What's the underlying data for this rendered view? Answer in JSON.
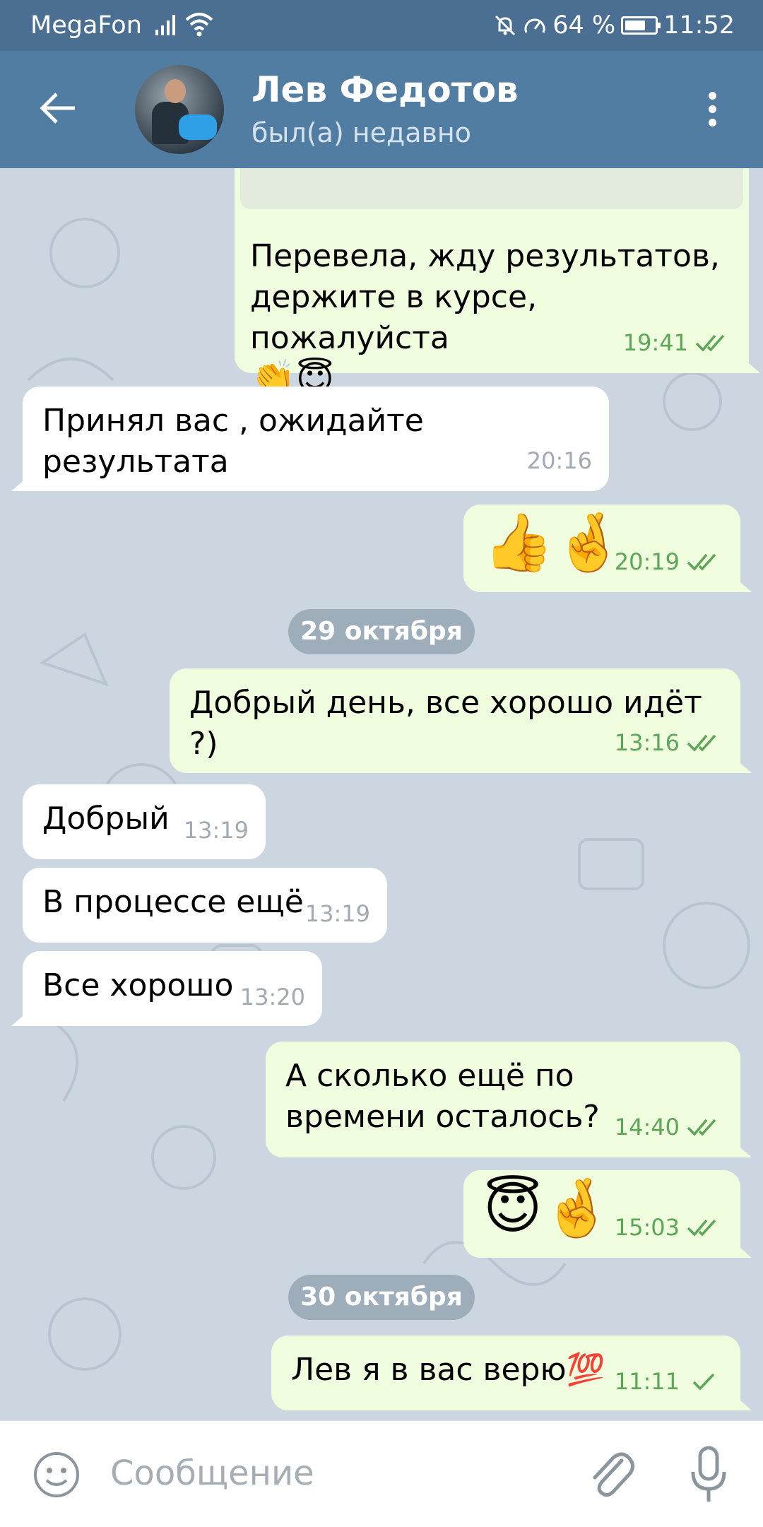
{
  "status_bar": {
    "carrier": "MegaFon",
    "battery": "64 %",
    "time": "11:52",
    "icons": [
      "signal-icon",
      "wifi-icon",
      "mute-icon",
      "speed-icon",
      "battery-icon"
    ]
  },
  "header": {
    "name": "Лев Федотов",
    "status": "был(а) недавно",
    "icons": [
      "back-arrow-icon",
      "avatar",
      "more-vert-icon"
    ]
  },
  "messages": [
    {
      "dir": "out",
      "text": "Перевела, жду результатов, держите в курсе, пожалуйста",
      "emoji": "👏😇",
      "time": "19:41",
      "read": true
    },
    {
      "dir": "in",
      "text": "Принял вас , ожидайте результата",
      "time": "20:16"
    },
    {
      "dir": "out",
      "emoji": "👍🤞",
      "time": "20:19",
      "read": true
    },
    {
      "dir": "out",
      "text": "Добрый день, все хорошо идёт ?)",
      "time": "13:16",
      "read": true
    },
    {
      "dir": "in",
      "text": "Добрый",
      "time": "13:19"
    },
    {
      "dir": "in",
      "text": "В процессе ещё",
      "time": "13:19"
    },
    {
      "dir": "in",
      "text": "Все хорошо",
      "time": "13:20"
    },
    {
      "dir": "out",
      "text": "А сколько ещё по времени осталось?",
      "time": "14:40",
      "read": true
    },
    {
      "dir": "out",
      "emoji": "😇🤞",
      "time": "15:03",
      "read": true
    },
    {
      "dir": "out",
      "text": "Лев я в вас верю💯",
      "time": "11:11",
      "read": false
    }
  ],
  "dates": [
    "29 октября",
    "30 октября"
  ],
  "composer": {
    "placeholder": "Сообщение",
    "icons": [
      "emoji-icon",
      "attach-icon",
      "mic-icon"
    ]
  },
  "colors": {
    "header": "#527da3",
    "status_bar": "#4a6f93",
    "incoming_bubble": "#ffffff",
    "outgoing_bubble": "#effdde",
    "check": "#5ba756",
    "background": "#cbd6e0"
  }
}
